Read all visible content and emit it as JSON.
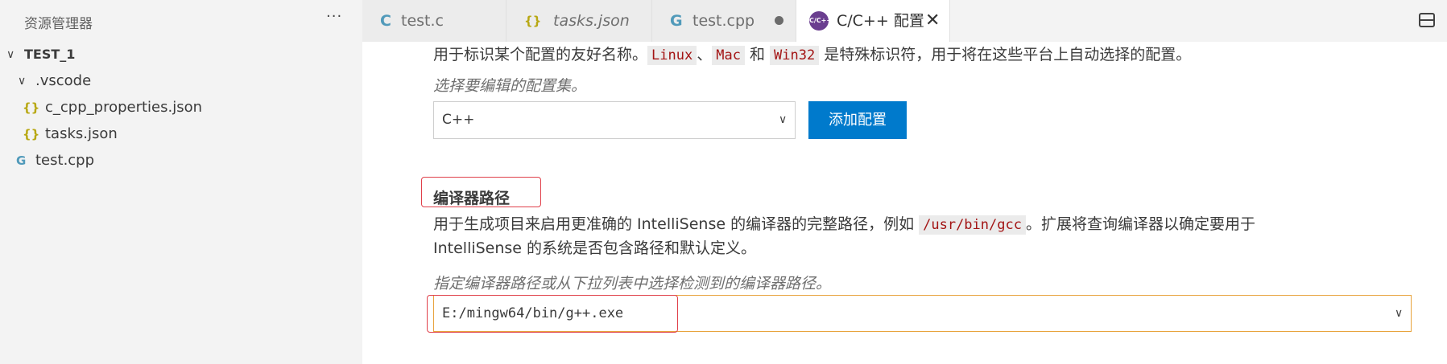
{
  "sidebar": {
    "title": "资源管理器",
    "more": "···",
    "root": "TEST_1",
    "folder": ".vscode",
    "files": [
      "c_cpp_properties.json",
      "tasks.json"
    ],
    "root_file": "test.cpp"
  },
  "tabs": [
    {
      "icon": "C",
      "label": "test.c"
    },
    {
      "icon": "{}",
      "label": "tasks.json"
    },
    {
      "icon": "G",
      "label": "test.cpp"
    },
    {
      "icon": "C/C++",
      "label": "C/C++ 配置"
    }
  ],
  "config": {
    "desc_prefix": "用于标识某个配置的友好名称。",
    "linux": "Linux",
    "sep1": "、",
    "mac": "Mac",
    "and": " 和 ",
    "win32": "Win32",
    "desc_suffix": " 是特殊标识符，用于将在这些平台上自动选择的配置。",
    "select_hint": "选择要编辑的配置集。",
    "selected_config": "C++",
    "add_button": "添加配置"
  },
  "compiler": {
    "title": "编译器路径",
    "desc_prefix": "用于生成项目来启用更准确的 IntelliSense 的编译器的完整路径，例如 ",
    "example": "/usr/bin/gcc",
    "desc_suffix": "。扩展将查询编译器以确定要用于",
    "desc_line2": "IntelliSense 的系统是否包含路径和默认定义。",
    "hint": "指定编译器路径或从下拉列表中选择检测到的编译器路径。",
    "value": "E:/mingw64/bin/g++.exe"
  },
  "colors": {
    "accent": "#007acc",
    "highlight_box": "#e0404a",
    "focused_border": "#e8a33d"
  }
}
